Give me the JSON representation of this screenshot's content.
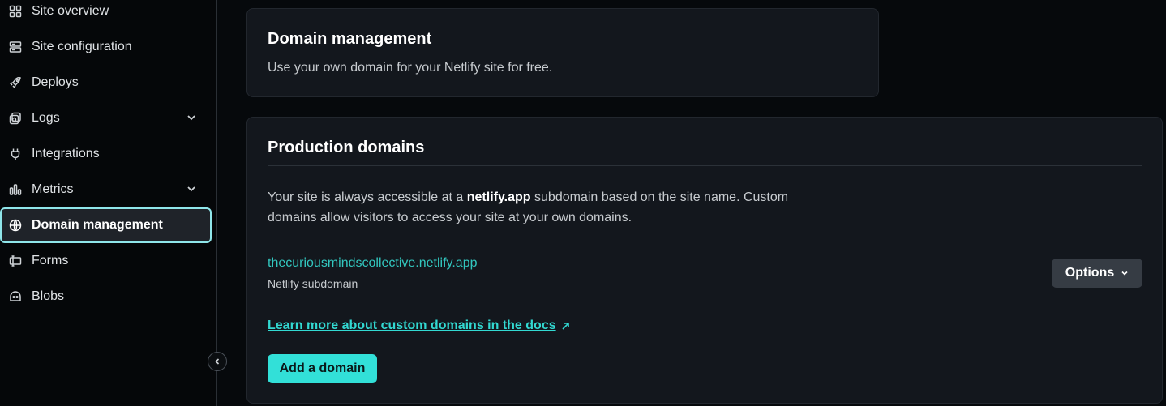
{
  "sidebar": {
    "items": [
      {
        "label": "Site overview",
        "icon": "grid-icon"
      },
      {
        "label": "Site configuration",
        "icon": "server-icon"
      },
      {
        "label": "Deploys",
        "icon": "rocket-icon"
      },
      {
        "label": "Logs",
        "icon": "logs-icon",
        "expandable": true
      },
      {
        "label": "Integrations",
        "icon": "plug-icon"
      },
      {
        "label": "Metrics",
        "icon": "bar-chart-icon",
        "expandable": true
      },
      {
        "label": "Domain management",
        "icon": "globe-icon",
        "active": true
      },
      {
        "label": "Forms",
        "icon": "form-icon"
      },
      {
        "label": "Blobs",
        "icon": "blob-icon"
      }
    ]
  },
  "domain_card": {
    "title": "Domain management",
    "description": "Use your own domain for your Netlify site for free."
  },
  "production": {
    "title": "Production domains",
    "intro_prefix": "Your site is always accessible at a ",
    "intro_bold": "netlify.app",
    "intro_suffix": " subdomain based on the site name. Custom domains allow visitors to access your site at your own domains.",
    "domain": "thecuriousmindscollective.netlify.app",
    "domain_sub": "Netlify subdomain",
    "options_label": "Options",
    "docs_link": "Learn more about custom domains in the docs",
    "add_button": "Add a domain"
  },
  "colors": {
    "accent": "#32e0d8",
    "link": "#32c7bf",
    "active_border": "#8fe6ea"
  }
}
